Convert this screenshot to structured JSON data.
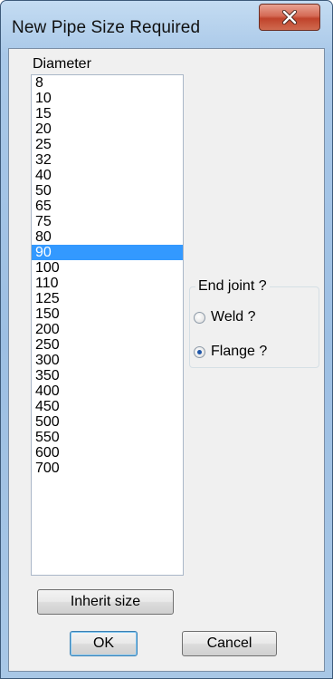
{
  "window": {
    "title": "New Pipe Size Required",
    "close_icon": "close-icon"
  },
  "diameter": {
    "label": "Diameter",
    "items": [
      "8",
      "10",
      "15",
      "20",
      "25",
      "32",
      "40",
      "50",
      "65",
      "75",
      "80",
      "90",
      "100",
      "110",
      "125",
      "150",
      "200",
      "250",
      "300",
      "350",
      "400",
      "450",
      "500",
      "550",
      "600",
      "700"
    ],
    "selected": "90"
  },
  "end_joint": {
    "title": "End joint ?",
    "options": [
      {
        "label": "Weld ?",
        "checked": false
      },
      {
        "label": "Flange ?",
        "checked": true
      }
    ]
  },
  "buttons": {
    "inherit": "Inherit size",
    "ok": "OK",
    "cancel": "Cancel"
  },
  "colors": {
    "selection": "#3399ff",
    "close_button": "#c0432b"
  }
}
